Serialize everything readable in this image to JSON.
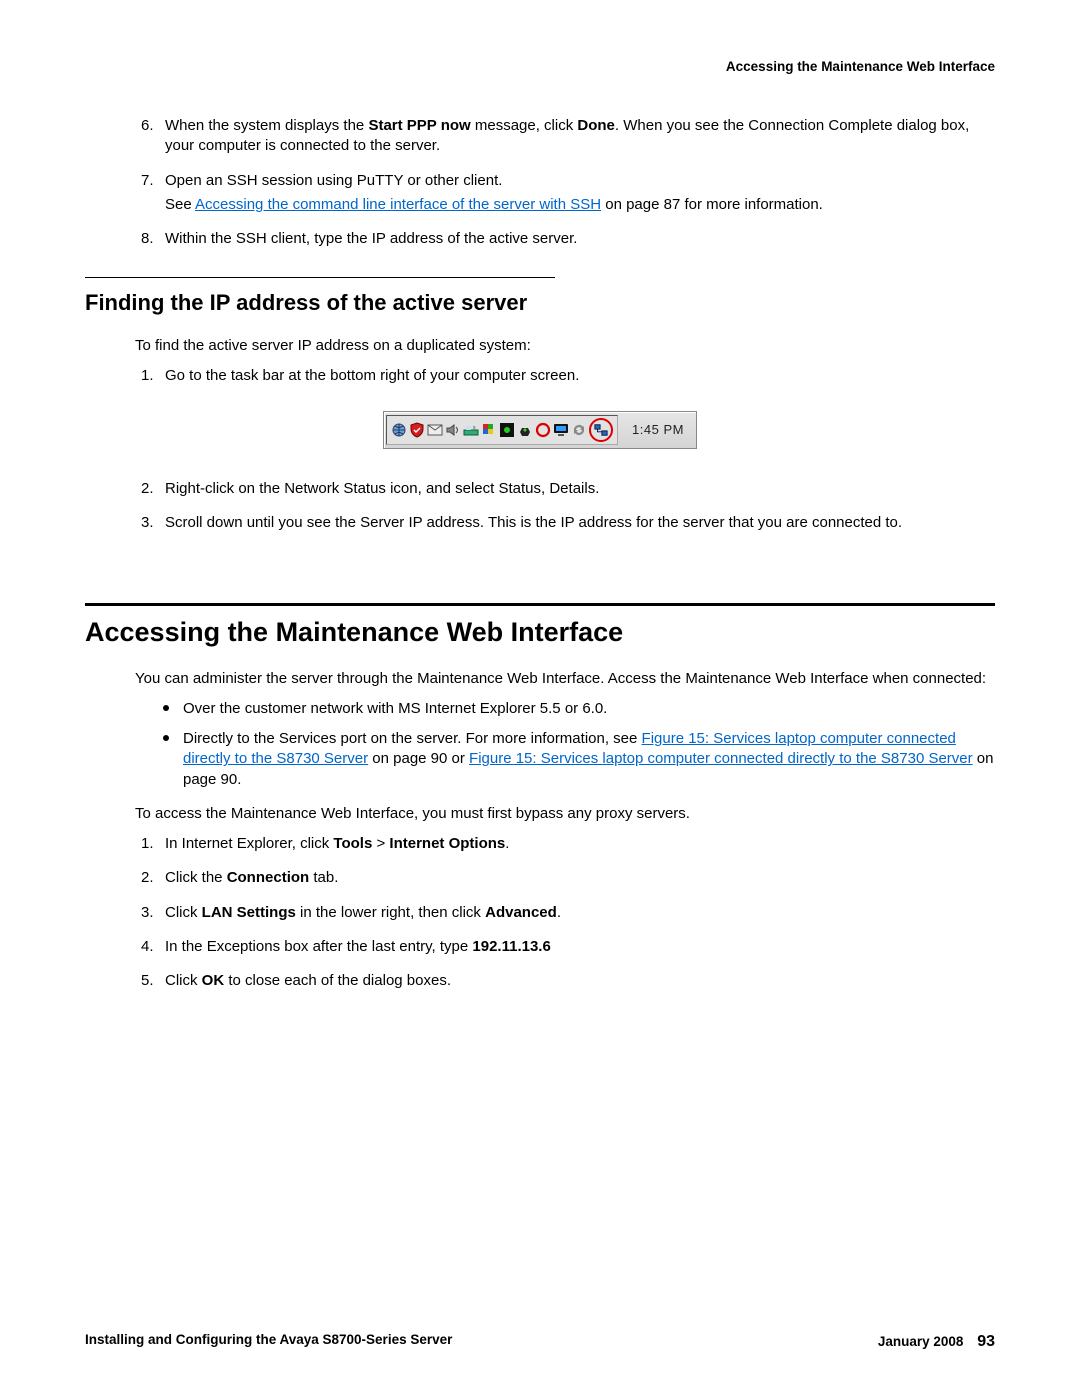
{
  "running_head": "Accessing the Maintenance Web Interface",
  "top_list": {
    "items": [
      {
        "num": "6.",
        "pre": "When the system displays the ",
        "b1": "Start PPP now",
        "mid": " message, click ",
        "b2": "Done",
        "post": ". When you see the Connection Complete dialog box, your computer is connected to the server."
      },
      {
        "num": "7.",
        "line": "Open an SSH session using PuTTY or other client.",
        "see_pre": "See ",
        "see_link": "Accessing the command line interface of the server with SSH",
        "see_post": " on page 87 for more information."
      },
      {
        "num": "8.",
        "line": "Within the SSH client, type the IP address of the active server."
      }
    ]
  },
  "section1": {
    "title": "Finding the IP address of the active server",
    "intro": "To find the active server IP address on a duplicated system:",
    "steps": [
      {
        "num": "1.",
        "text": "Go to the task bar at the bottom right of your computer screen."
      },
      {
        "num": "2.",
        "text": "Right-click on the Network Status icon, and select Status, Details."
      },
      {
        "num": "3.",
        "text": "Scroll down until you see the Server IP address. This is the IP address for the server that you are connected to."
      }
    ]
  },
  "taskbar": {
    "clock": "1:45 PM",
    "icons": [
      "globe",
      "shield",
      "mail",
      "speaker",
      "modem",
      "flag",
      "security",
      "recycle",
      "net",
      "monitor",
      "sync",
      "terminal"
    ]
  },
  "section2": {
    "title": "Accessing the Maintenance Web Interface",
    "intro": "You can administer the server through the Maintenance Web Interface. Access the Maintenance Web Interface when connected:",
    "bullets": [
      {
        "text": "Over the customer network with MS Internet Explorer 5.5 or 6.0."
      },
      {
        "pre": "Directly to the Services port on the server. For more information, see ",
        "link1": "Figure 15:  Services laptop computer connected directly to the S8730 Server",
        "mid1": " on page 90 or ",
        "link2": "Figure 15:  Services laptop computer connected directly to the S8730 Server",
        "mid2": " on page 90."
      }
    ],
    "proxy_intro": "To access the Maintenance Web Interface, you must first bypass any proxy servers.",
    "steps": [
      {
        "num": "1.",
        "pre": "In Internet Explorer, click ",
        "b1": "Tools",
        "mid": " > ",
        "b2": "Internet Options",
        "post": "."
      },
      {
        "num": "2.",
        "pre": "Click the ",
        "b1": "Connection",
        "post": " tab."
      },
      {
        "num": "3.",
        "pre": "Click ",
        "b1": "LAN Settings",
        "mid": " in the lower right, then click ",
        "b2": "Advanced",
        "post": "."
      },
      {
        "num": "4.",
        "pre": "In the Exceptions box after the last entry, type ",
        "b1": "192.11.13.6"
      },
      {
        "num": "5.",
        "pre": "Click ",
        "b1": "OK",
        "post": " to close each of the dialog boxes."
      }
    ]
  },
  "footer": {
    "left": "Installing and Configuring the Avaya S8700-Series Server",
    "right_date": "January 2008",
    "page": "93"
  }
}
